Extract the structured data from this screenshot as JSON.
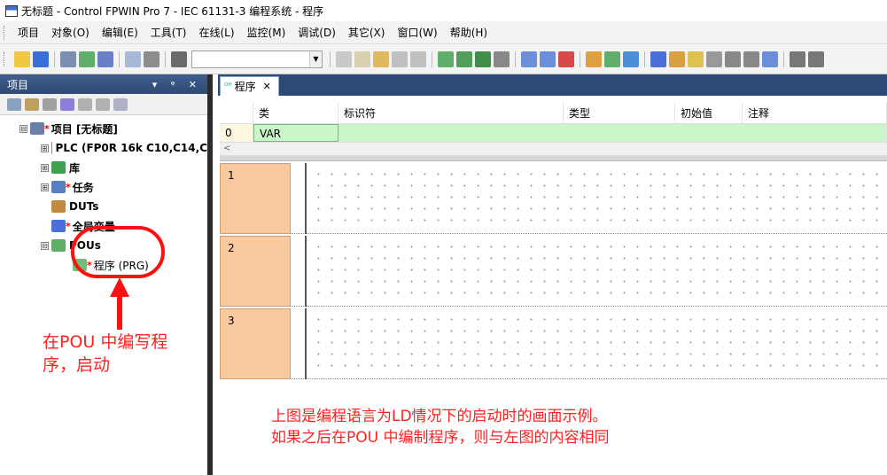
{
  "window": {
    "title": "无标题 - Control FPWIN Pro 7 - IEC 61131-3 编程系统 - 程序"
  },
  "menu": [
    "项目",
    "对象(O)",
    "编辑(E)",
    "工具(T)",
    "在线(L)",
    "监控(M)",
    "调试(D)",
    "其它(X)",
    "窗口(W)",
    "帮助(H)"
  ],
  "toolbar": {
    "combo_value": ""
  },
  "project_panel": {
    "title": "项目",
    "header_icons": "▾ ᵠ ✕",
    "tree": [
      {
        "label": "项目 [无标题]",
        "star": "*",
        "icon": "project-icon",
        "expander": "⊟"
      },
      {
        "label": "PLC (FP0R 16k C10,C14,C",
        "icon": "plc-icon",
        "expander": "⊞"
      },
      {
        "label": "库",
        "icon": "library-icon",
        "expander": "⊞"
      },
      {
        "label": "任务",
        "star": "*",
        "icon": "task-icon",
        "expander": "⊞"
      },
      {
        "label": "DUTs",
        "icon": "dut-icon"
      },
      {
        "label": "全局变量",
        "star": "*",
        "icon": "global-var-icon"
      },
      {
        "label": "POUs",
        "icon": "pou-icon",
        "expander": "⊟"
      },
      {
        "label": "程序 (PRG)",
        "star": "*",
        "icon": "program-icon"
      }
    ]
  },
  "annotation_left": {
    "line1": "在POU 中编写程",
    "line2": "序，启动"
  },
  "editor": {
    "tab_label": "程序",
    "tab_icon": "ᴰᴴ",
    "tab_close": "✕",
    "var_table": {
      "headers": [
        "",
        "类",
        "标识符",
        "类型",
        "初始值",
        "注释"
      ],
      "rows": [
        {
          "num": "0",
          "kind": "VAR",
          "id": "",
          "type": "",
          "init": "",
          "comment": ""
        }
      ]
    },
    "scroll_left": "<",
    "networks": [
      "1",
      "2",
      "3"
    ]
  },
  "annotation_bottom": {
    "line1": "上图是编程语言为LD情况下的启动时的画面示例。",
    "line2": "如果之后在POU 中编制程序，则与左图的内容相同"
  },
  "colors": {
    "annotation": "#ff2020",
    "network_number_bg": "#fbc9a0",
    "var_row_bg": "#c9f7c9",
    "panel_header": "#2d4a74"
  }
}
